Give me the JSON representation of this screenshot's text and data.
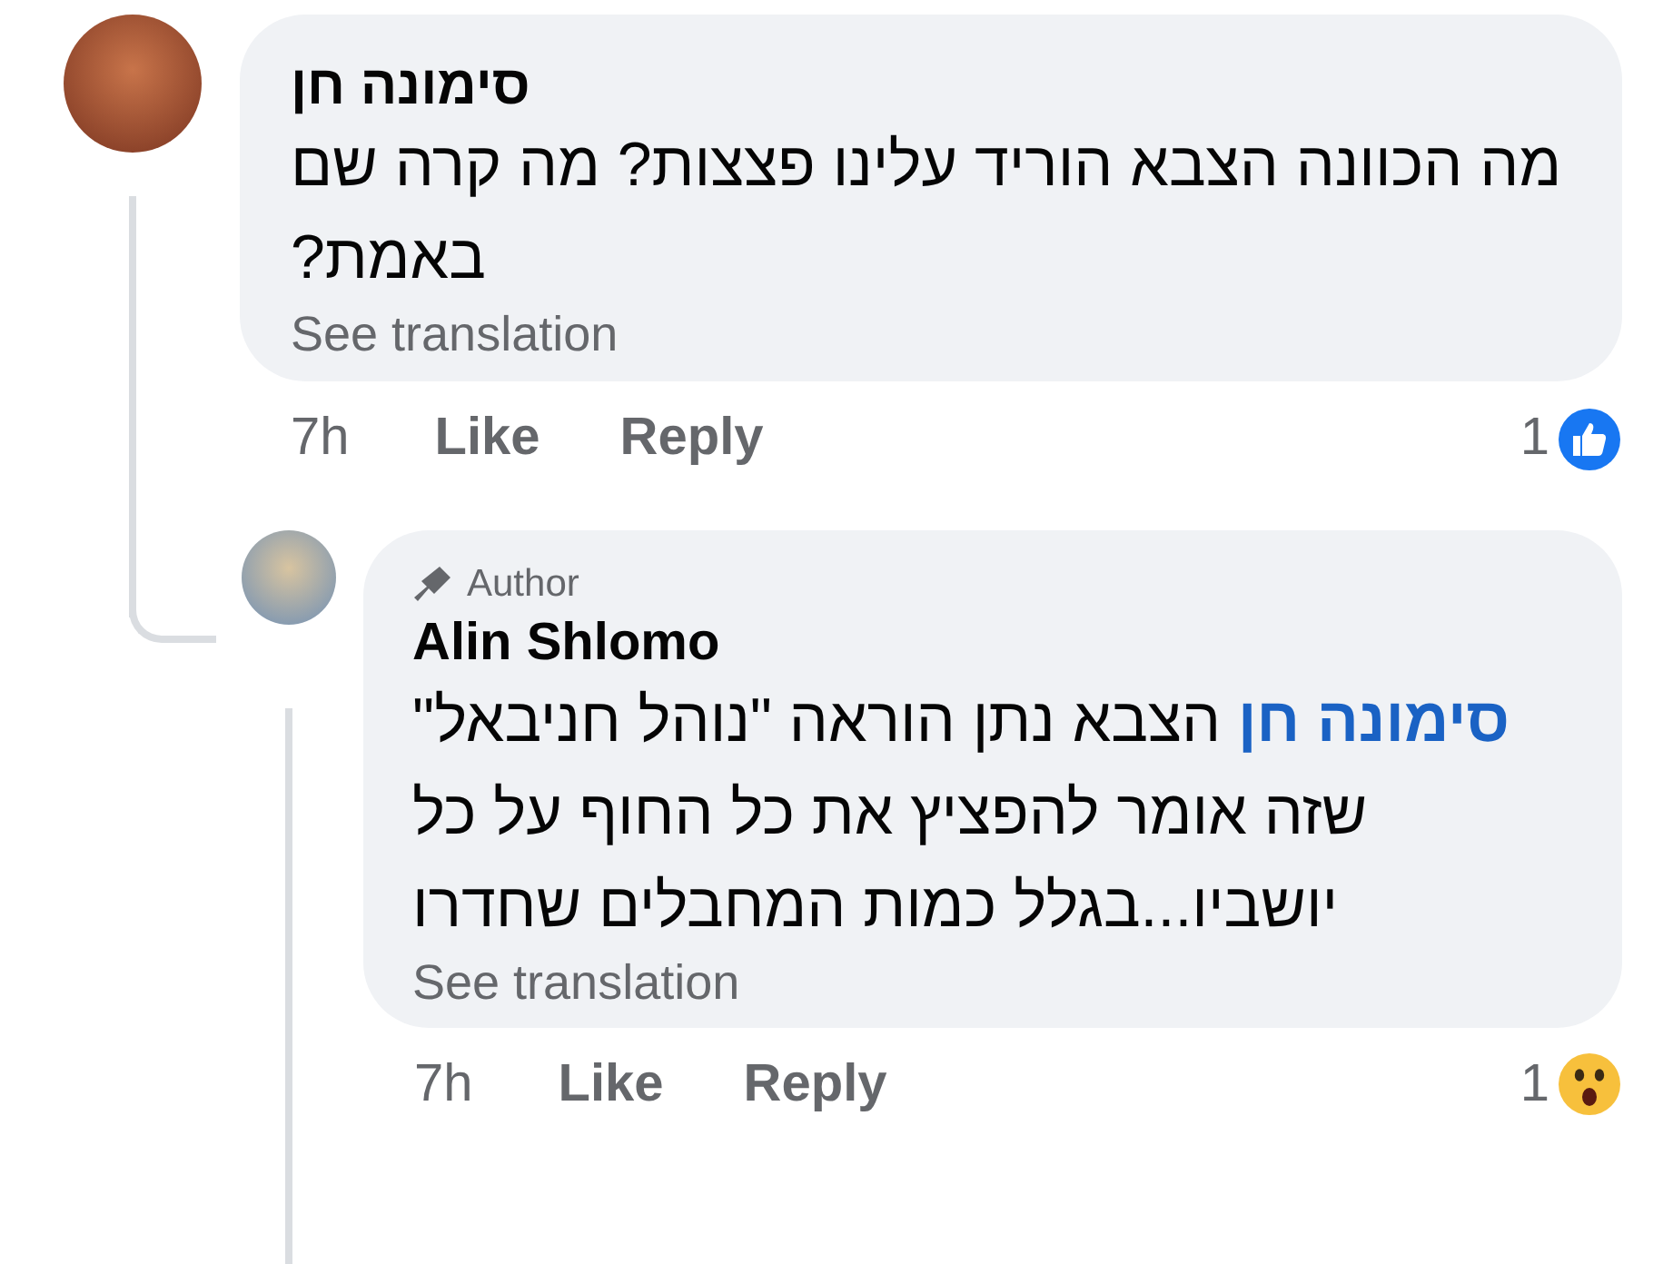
{
  "comments": [
    {
      "author": "סימונה חן",
      "text": "מה הכוונה הצבא הוריד עלינו פצצות? מה קרה שם באמת?",
      "translate": "See translation",
      "time": "7h",
      "like_label": "Like",
      "reply_label": "Reply",
      "reaction_count": "1",
      "reaction": {
        "kind": "like"
      }
    },
    {
      "author": "Alin Shlomo",
      "author_badge": "Author",
      "mention": "סימונה חן",
      "text": "הצבא נתן הוראה \"נוהל חניבאל\" שזה אומר להפציץ את כל החוף על כל יושביו...בגלל כמות המחבלים שחדרו",
      "translate": "See translation",
      "time": "7h",
      "like_label": "Like",
      "reply_label": "Reply",
      "reaction_count": "1",
      "reaction": {
        "kind": "wow"
      }
    }
  ]
}
